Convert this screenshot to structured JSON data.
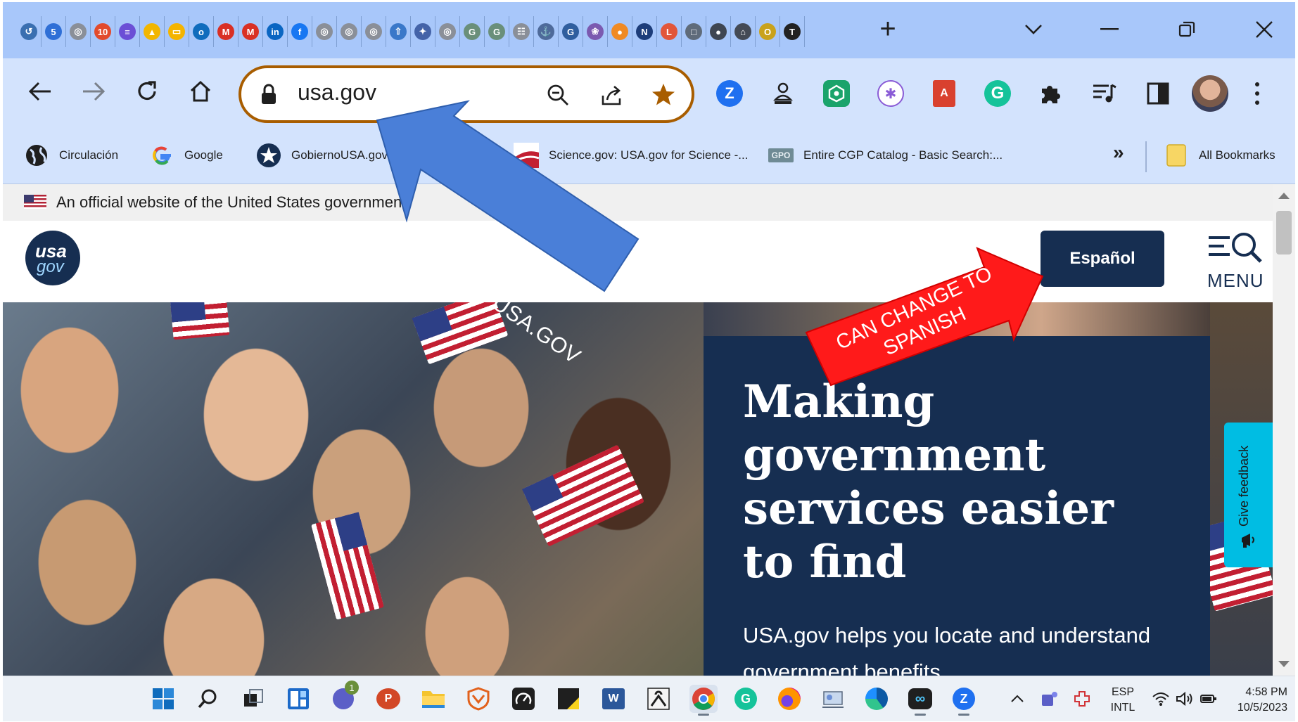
{
  "browser": {
    "tabs": [
      {
        "icon": "swirl-icon",
        "color": "#3a6fb0",
        "glyph": "↺"
      },
      {
        "icon": "calendar-5-icon",
        "color": "#2f6fd6",
        "glyph": "5"
      },
      {
        "icon": "gray-globe-icon",
        "color": "#8a8f98",
        "glyph": "◎"
      },
      {
        "icon": "calendar-10-icon",
        "color": "#e24a2c",
        "glyph": "10"
      },
      {
        "icon": "purple-list-icon",
        "color": "#6b4fd6",
        "glyph": "≡"
      },
      {
        "icon": "google-drive-icon",
        "color": "#f2b600",
        "glyph": "▲"
      },
      {
        "icon": "google-slides-icon",
        "color": "#f4b400",
        "glyph": "▭"
      },
      {
        "icon": "outlook-icon",
        "color": "#0f6cbd",
        "glyph": "o"
      },
      {
        "icon": "gmail-icon",
        "color": "#d93025",
        "glyph": "M"
      },
      {
        "icon": "gmail-icon",
        "color": "#d93025",
        "glyph": "M"
      },
      {
        "icon": "linkedin-icon",
        "color": "#0a66c2",
        "glyph": "in"
      },
      {
        "icon": "facebook-icon",
        "color": "#1877f2",
        "glyph": "f"
      },
      {
        "icon": "gray-globe-icon",
        "color": "#8a8f98",
        "glyph": "◎"
      },
      {
        "icon": "gray-globe-icon",
        "color": "#8a8f98",
        "glyph": "◎"
      },
      {
        "icon": "gray-globe-icon",
        "color": "#8a8f98",
        "glyph": "◎"
      },
      {
        "icon": "upload-icon",
        "color": "#3a78c9",
        "glyph": "⇧"
      },
      {
        "icon": "seal-icon",
        "color": "#4463a8",
        "glyph": "✦"
      },
      {
        "icon": "gray-globe-icon",
        "color": "#8a8f98",
        "glyph": "◎"
      },
      {
        "icon": "gpo-icon",
        "color": "#6a8f7a",
        "glyph": "G"
      },
      {
        "icon": "gpo-icon",
        "color": "#6a8f7a",
        "glyph": "G"
      },
      {
        "icon": "document-icon",
        "color": "#8a8f98",
        "glyph": "☷"
      },
      {
        "icon": "ship-icon",
        "color": "#4e6a9a",
        "glyph": "⚓"
      },
      {
        "icon": "gao-icon",
        "color": "#2f5e9e",
        "glyph": "G"
      },
      {
        "icon": "swirl-icon",
        "color": "#7b5ab0",
        "glyph": "❀"
      },
      {
        "icon": "orange-icon",
        "color": "#f08a24",
        "glyph": "●"
      },
      {
        "icon": "n-icon",
        "color": "#1d3d7a",
        "glyph": "N"
      },
      {
        "icon": "loc-icon",
        "color": "#e2563a",
        "glyph": "L"
      },
      {
        "icon": "page-icon",
        "color": "#5f6b7a",
        "glyph": "□"
      },
      {
        "icon": "dark-circle-icon",
        "color": "#3f4652",
        "glyph": "●"
      },
      {
        "icon": "archives-icon",
        "color": "#444a55",
        "glyph": "⌂"
      },
      {
        "icon": "open-icon",
        "color": "#c9a21c",
        "glyph": "O"
      },
      {
        "icon": "nyt-icon",
        "color": "#222222",
        "glyph": "T"
      }
    ],
    "omnibox": {
      "url": "usa.gov"
    },
    "bookmarks": [
      {
        "icon": "globe-icon",
        "label": "Circulación"
      },
      {
        "icon": "google-icon",
        "label": "Google"
      },
      {
        "icon": "gobiernousa-icon",
        "label": "GobiernoUSA.gov"
      },
      {
        "icon": "science-gov-icon",
        "label": "Science.gov: USA.gov for Science -..."
      },
      {
        "icon": "gpo-icon",
        "label": "Entire CGP Catalog - Basic Search:..."
      }
    ],
    "all_bookmarks_label": "All Bookmarks"
  },
  "page": {
    "banner_text": "An official website of the United States government",
    "logo": {
      "line1": "usa",
      "line2": "gov"
    },
    "espanol_label": "Español",
    "menu_label": "MENU",
    "hero": {
      "title": "Making government services easier to find",
      "subtitle": "USA.gov helps you locate and understand government benefits"
    },
    "feedback_label": "Give feedback"
  },
  "annotations": {
    "search_arrow_label": "SEARCH IN USA.GOV",
    "spanish_arrow_label": "CAN CHANGE TO SPANISH",
    "search_arrow_color": "#4a7fd8",
    "spanish_arrow_color": "#ff1a1a"
  },
  "taskbar": {
    "apps": [
      "windows-start-icon",
      "search-icon",
      "task-view-icon",
      "widgets-icon",
      "teams-chat-icon",
      "powerpoint-icon",
      "file-explorer-icon",
      "shield-app-icon",
      "speedometer-icon",
      "sticky-notes-icon",
      "word-icon",
      "reader-icon",
      "chrome-icon",
      "grammarly-icon",
      "firefox-icon",
      "kiosk-icon",
      "edge-icon",
      "copilot-icon",
      "zoom-icon"
    ],
    "chat_badge": "1",
    "tray": {
      "lang_line1": "ESP",
      "lang_line2": "INTL",
      "time": "4:58 PM",
      "date": "10/5/2023"
    }
  }
}
